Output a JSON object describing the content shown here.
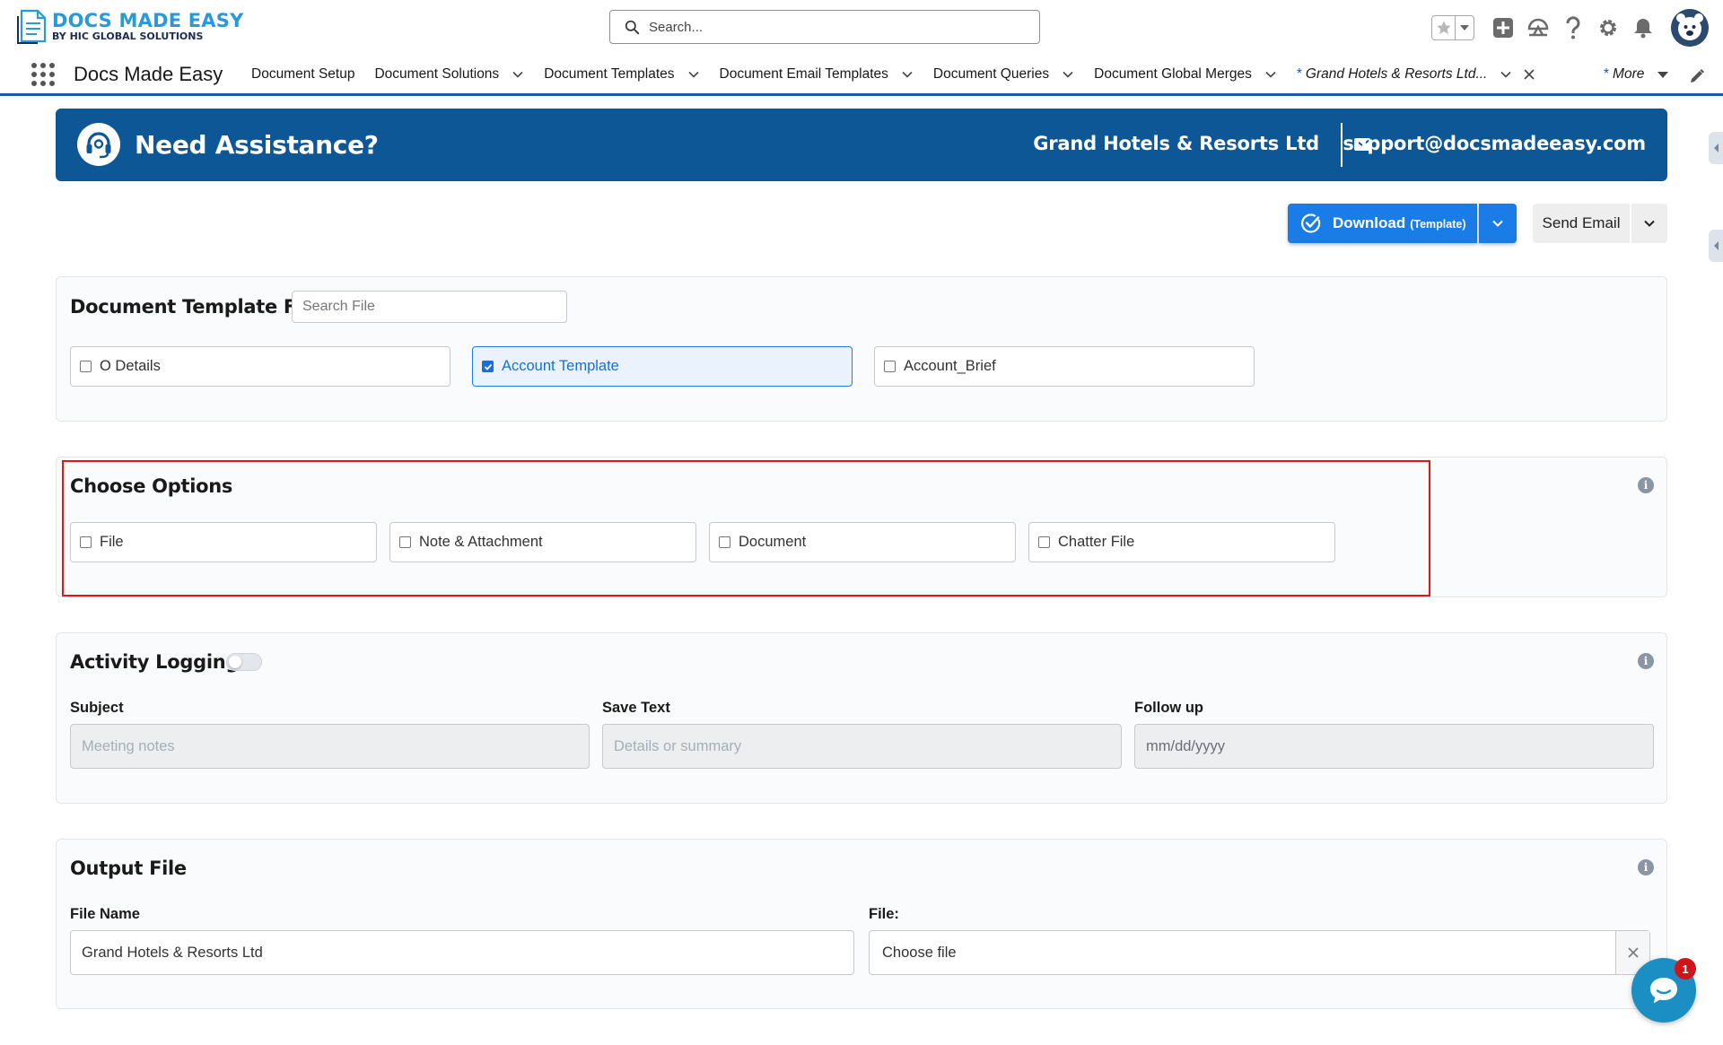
{
  "header": {
    "logo_title": "DOCS MADE EASY",
    "logo_subtitle": "BY HIC GLOBAL SOLUTIONS",
    "search_placeholder": "Search...",
    "icons": [
      "star-icon",
      "chevron-down-icon",
      "add-icon",
      "trailhead-icon",
      "help-icon",
      "gear-icon",
      "bell-icon",
      "avatar"
    ]
  },
  "nav": {
    "app_name": "Docs Made Easy",
    "items": [
      {
        "label": "Document Setup",
        "has_menu": false
      },
      {
        "label": "Document Solutions",
        "has_menu": true
      },
      {
        "label": "Document Templates",
        "has_menu": true
      },
      {
        "label": "Document Email Templates",
        "has_menu": true
      },
      {
        "label": "Document Queries",
        "has_menu": true
      },
      {
        "label": "Document Global Merges",
        "has_menu": true
      }
    ],
    "active_tab": {
      "marker": "*",
      "label": "Grand Hotels & Resorts Ltd..."
    },
    "more": {
      "marker": "*",
      "label": "More"
    }
  },
  "banner": {
    "title": "Need Assistance?",
    "company": "Grand Hotels & Resorts Ltd",
    "email": "support@docsmadeeasy.com"
  },
  "actions": {
    "download_label": "Download",
    "download_sub": "(Template)",
    "send_email_label": "Send Email"
  },
  "template_file": {
    "title": "Document Template File",
    "search_placeholder": "Search File",
    "options": [
      {
        "label": "O Details",
        "checked": false
      },
      {
        "label": "Account Template",
        "checked": true
      },
      {
        "label": "Account_Brief",
        "checked": false
      }
    ]
  },
  "choose_options": {
    "title": "Choose Options",
    "options": [
      {
        "label": "File",
        "checked": false
      },
      {
        "label": "Note & Attachment",
        "checked": false
      },
      {
        "label": "Document",
        "checked": false
      },
      {
        "label": "Chatter File",
        "checked": false
      }
    ]
  },
  "activity_logging": {
    "title": "Activity Logging",
    "enabled": false,
    "subject_label": "Subject",
    "subject_placeholder": "Meeting notes",
    "save_text_label": "Save Text",
    "save_text_placeholder": "Details or summary",
    "follow_up_label": "Follow up",
    "follow_up_placeholder": "mm/dd/yyyy"
  },
  "output_file": {
    "title": "Output File",
    "file_name_label": "File Name",
    "file_name_value": "Grand Hotels & Resorts Ltd",
    "file_label": "File:",
    "file_value": "Choose file"
  },
  "chat": {
    "badge_count": "1"
  },
  "colors": {
    "brand_blue": "#0d5796",
    "primary_button": "#1a7ce7",
    "nav_underline": "#1b5aa4",
    "highlight_border": "#e8141c"
  }
}
